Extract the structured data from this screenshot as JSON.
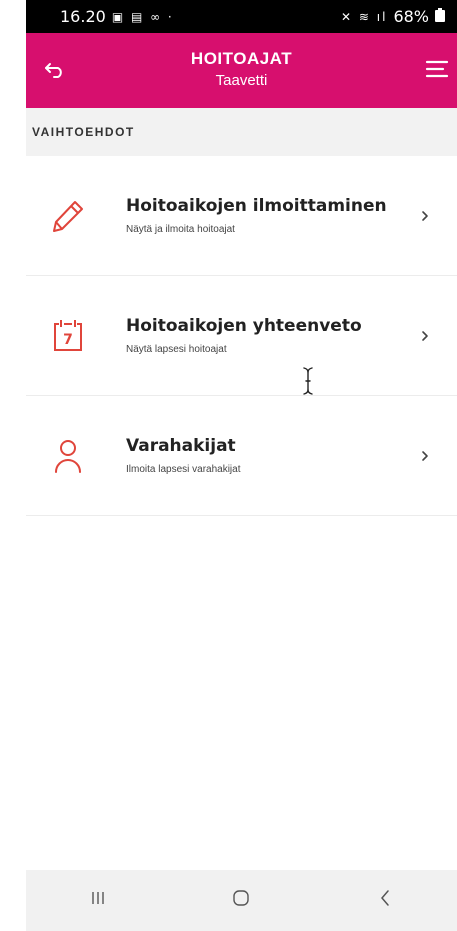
{
  "status_bar": {
    "time": "16.20",
    "left_icons": "▣ ▤ ∞ ·",
    "right_icons": "✕ ≋ ıl",
    "battery": "68%"
  },
  "header": {
    "title": "HOITOAJAT",
    "subtitle": "Taavetti"
  },
  "section": {
    "label": "VAIHTOEHDOT"
  },
  "options": [
    {
      "icon": "pencil-icon",
      "title": "Hoitoaikojen ilmoittaminen",
      "subtitle": "Näytä ja ilmoita hoitoajat"
    },
    {
      "icon": "calendar-icon",
      "icon_text": "7",
      "title": "Hoitoaikojen yhteenveto",
      "subtitle": "Näytä lapsesi hoitoajat"
    },
    {
      "icon": "person-icon",
      "title": "Varahakijat",
      "subtitle": "Ilmoita lapsesi varahakijat"
    }
  ],
  "colors": {
    "brand": "#d70f6e",
    "icon_accent": "#e0453b"
  }
}
